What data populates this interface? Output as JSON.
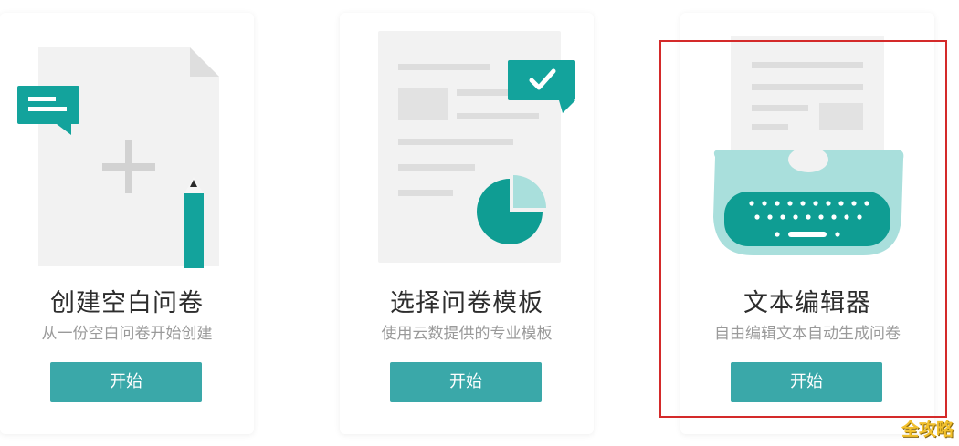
{
  "cards": [
    {
      "title": "创建空白问卷",
      "subtitle": "从一份空白问卷开始创建",
      "button_label": "开始"
    },
    {
      "title": "选择问卷模板",
      "subtitle": "使用云数提供的专业模板",
      "button_label": "开始"
    },
    {
      "title": "文本编辑器",
      "subtitle": "自由编辑文本自动生成问卷",
      "button_label": "开始",
      "selected": true
    }
  ],
  "watermark": "全攻略",
  "colors": {
    "accent": "#3aa8a9",
    "accent_dark": "#139d96",
    "accent_light": "#a9dfdc",
    "selection_border": "#d42a2a"
  },
  "icons": [
    "chat-bubble-icon",
    "plus-icon",
    "pencil-icon",
    "check-icon",
    "pie-chart-icon",
    "typewriter-icon"
  ]
}
